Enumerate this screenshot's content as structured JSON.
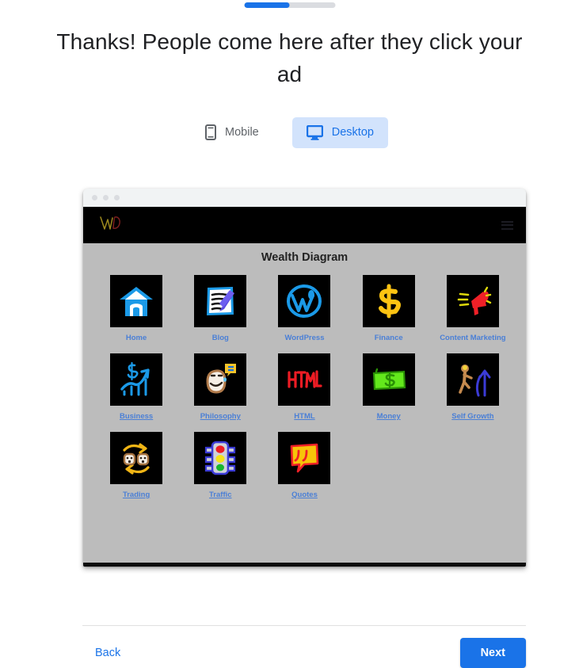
{
  "progress": {
    "percent": 50
  },
  "headline": "Thanks! People come here after they click your ad",
  "device_toggle": {
    "mobile_label": "Mobile",
    "desktop_label": "Desktop",
    "selected": "Desktop",
    "active_bg": "#d2e3fc",
    "active_fg": "#1a73e8",
    "inactive_fg": "#5f6368"
  },
  "preview": {
    "logo_text": "WD",
    "logo_w_color": "#9e8a1e",
    "logo_d_color": "#7a1f1f",
    "header_bg": "#000000",
    "body_bg": "#bcbcbc",
    "site_title": "Wealth Diagram",
    "link_color": "#4a7fd6",
    "tiles": [
      {
        "label": "Home",
        "icon": "house-icon",
        "underlined": false
      },
      {
        "label": "Blog",
        "icon": "notepad-pen-icon",
        "underlined": false
      },
      {
        "label": "WordPress",
        "icon": "wordpress-icon",
        "underlined": false
      },
      {
        "label": "Finance",
        "icon": "dollar-sign-icon",
        "underlined": false
      },
      {
        "label": "Content Marketing",
        "icon": "megaphone-icon",
        "underlined": false
      },
      {
        "label": "Business",
        "icon": "growth-chart-icon",
        "underlined": true
      },
      {
        "label": "Philosophy",
        "icon": "thinking-face-icon",
        "underlined": true
      },
      {
        "label": "HTML",
        "icon": "html-text-icon",
        "underlined": true
      },
      {
        "label": "Money",
        "icon": "banknote-icon",
        "underlined": true
      },
      {
        "label": "Self Growth",
        "icon": "person-arrow-up-icon",
        "underlined": true
      },
      {
        "label": "Trading",
        "icon": "exchange-faces-icon",
        "underlined": true
      },
      {
        "label": "Traffic",
        "icon": "traffic-light-icon",
        "underlined": true
      },
      {
        "label": "Quotes",
        "icon": "quote-marks-icon",
        "underlined": true
      }
    ]
  },
  "footer": {
    "back_label": "Back",
    "next_label": "Next",
    "next_bg": "#1a73e8",
    "link_color": "#1a73e8"
  }
}
